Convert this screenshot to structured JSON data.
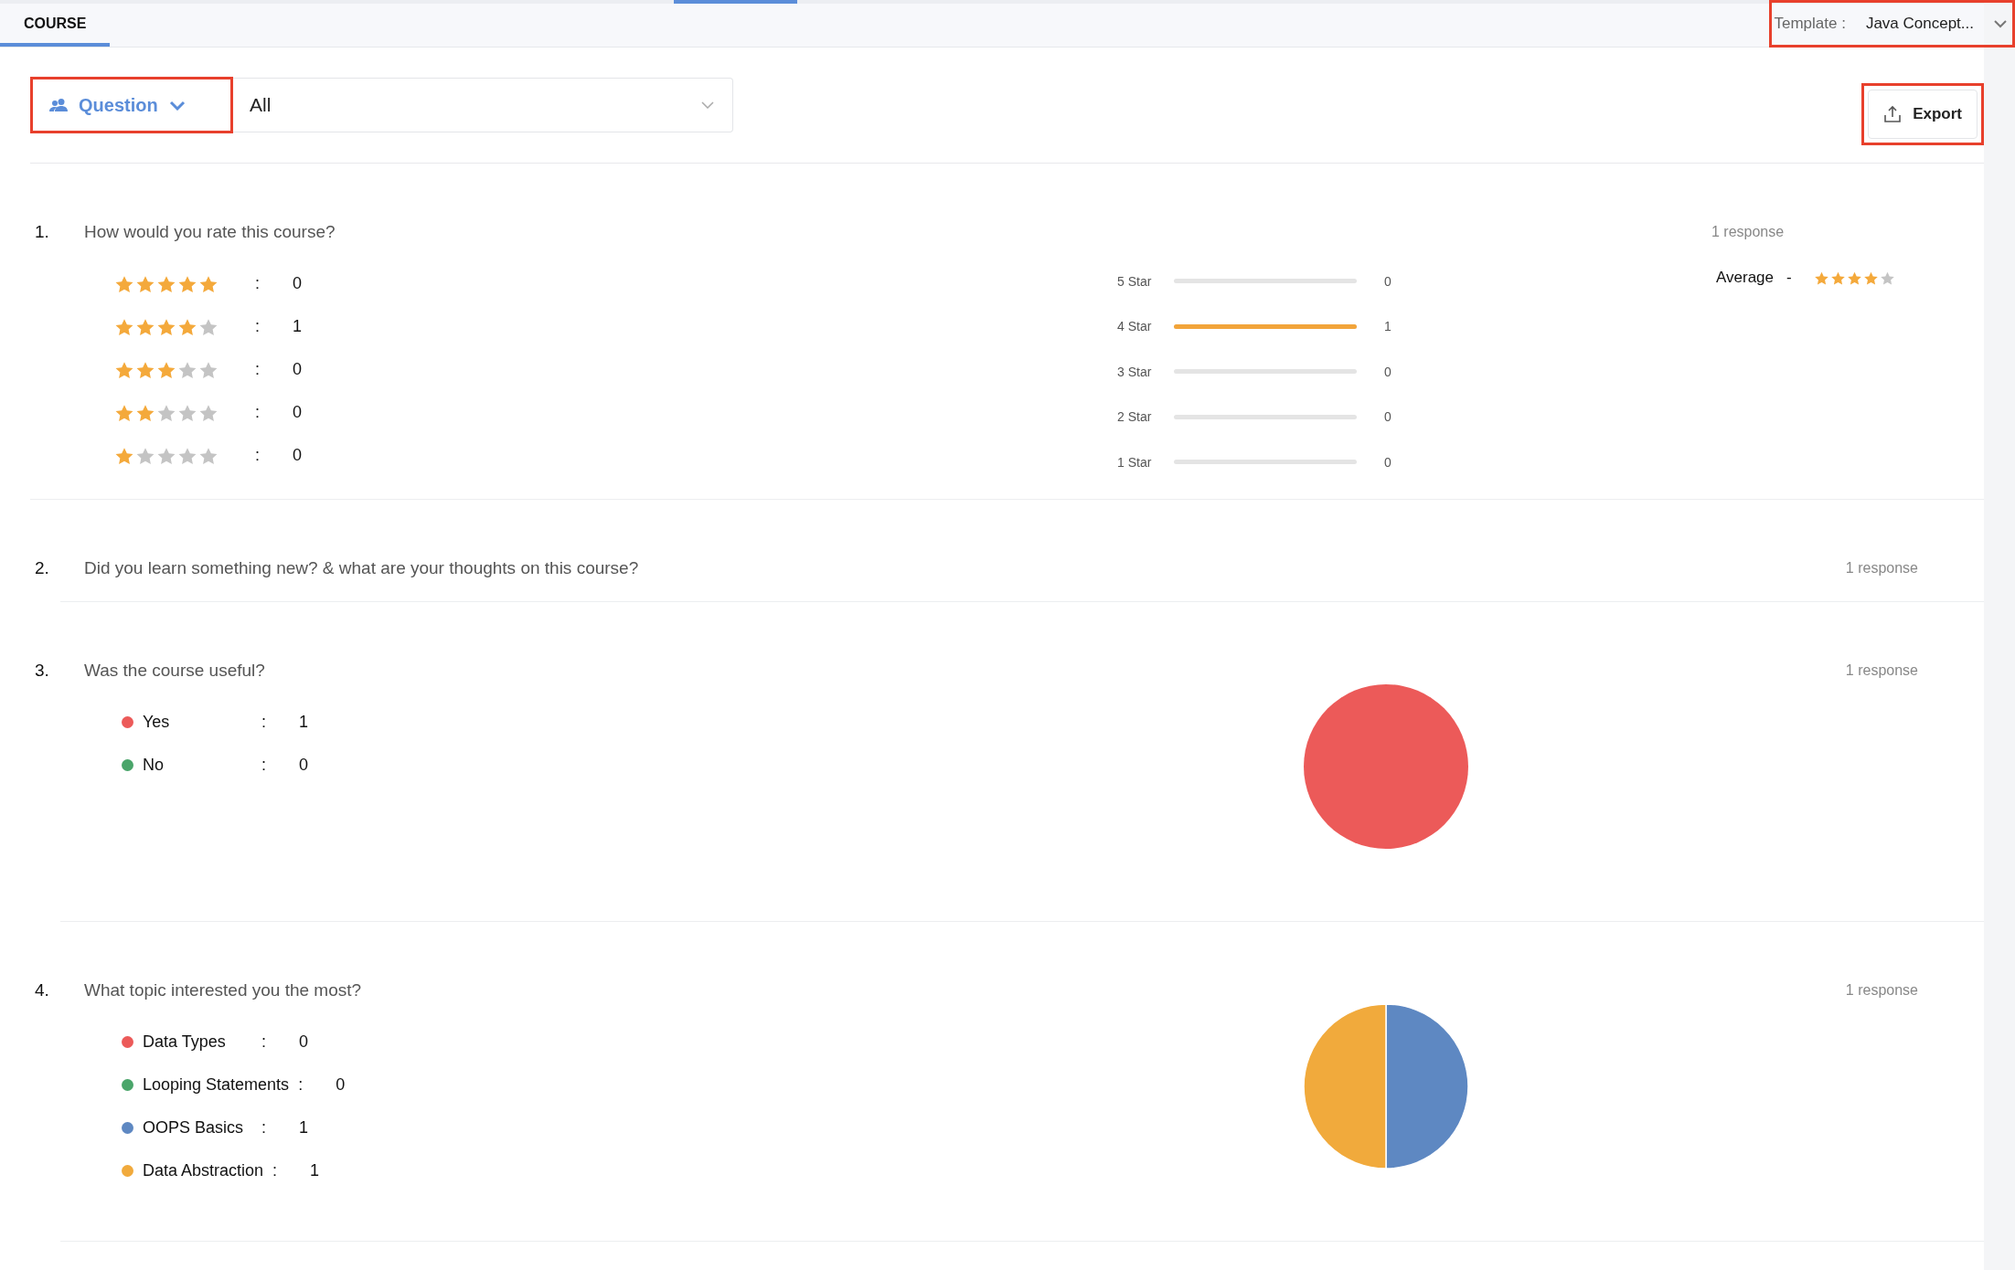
{
  "tab": {
    "label": "COURSE",
    "selected": true
  },
  "template": {
    "label": "Template :",
    "value": "Java Concept...",
    "highlighted": true
  },
  "filter": {
    "mode": "Question",
    "value": "All",
    "highlighted": true
  },
  "export": {
    "label": "Export",
    "highlighted": true
  },
  "questions": [
    {
      "kind": "rating",
      "number": "1.",
      "text": "How would you rate this course?",
      "responses": "1 response",
      "rating_rows": [
        {
          "stars": 5,
          "separator": ":",
          "count": "0"
        },
        {
          "stars": 4,
          "separator": ":",
          "count": "1"
        },
        {
          "stars": 3,
          "separator": ":",
          "count": "0"
        },
        {
          "stars": 2,
          "separator": ":",
          "count": "0"
        },
        {
          "stars": 1,
          "separator": ":",
          "count": "0"
        }
      ],
      "bars": [
        {
          "label": "5 Star",
          "level": 0,
          "count": "0"
        },
        {
          "label": "4 Star",
          "level": 1,
          "count": "1"
        },
        {
          "label": "3 Star",
          "level": 0,
          "count": "0"
        },
        {
          "label": "2 Star",
          "level": 0,
          "count": "0"
        },
        {
          "label": "1 Star",
          "level": 0,
          "count": "0"
        }
      ],
      "average": {
        "label": "Average",
        "separator": "-",
        "stars": 4
      }
    },
    {
      "kind": "text",
      "number": "2.",
      "text": "Did you learn something new? & what are your thoughts on this course?",
      "responses": "1 response"
    },
    {
      "kind": "choice",
      "number": "3.",
      "text": "Was the course useful?",
      "responses": "1 response",
      "options": [
        {
          "color": "#ec5a59",
          "separator": ":",
          "count": "1"
        },
        {
          "color": "#4aa56a",
          "separator": ":",
          "count": "0"
        }
      ],
      "chart_data": {
        "type": "pie",
        "categories": [
          "Yes",
          "No"
        ],
        "values": [
          1,
          0
        ]
      }
    },
    {
      "kind": "choice",
      "number": "4.",
      "text": "What topic interested you the most?",
      "responses": "1 response",
      "options": [
        {
          "color": "#ec5a59",
          "separator": ":",
          "count": "0"
        },
        {
          "color": "#4aa56a",
          "separator": ":",
          "count": "0"
        },
        {
          "color": "#5e88c2",
          "separator": ":",
          "count": "1"
        },
        {
          "color": "#f1aa3c",
          "separator": ":",
          "count": "1"
        }
      ],
      "chart_data": {
        "type": "pie",
        "categories": [
          "Data Types",
          "Looping Statements",
          "OOPS Basics",
          "Data Abstraction"
        ],
        "values": [
          0,
          0,
          50,
          50
        ]
      }
    }
  ]
}
